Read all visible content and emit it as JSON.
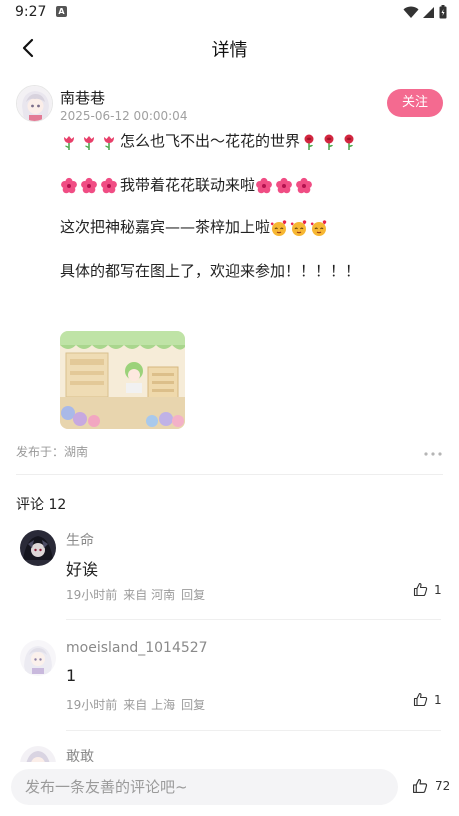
{
  "status_bar": {
    "time": "9:27",
    "notif_letter": "A"
  },
  "header": {
    "title": "详情"
  },
  "author": {
    "name": "南巷巷",
    "date": "2025-06-12 00:00:04",
    "follow_label": "关注"
  },
  "post": {
    "lines": [
      {
        "text": "怎么也飞不出～花花的世界",
        "pre_emoji": [
          "tulip",
          "tulip",
          "tulip"
        ],
        "post_emoji": [
          "rose",
          "rose",
          "rose"
        ]
      },
      {
        "text": "我带着花花联动来啦",
        "pre_emoji": [
          "hibiscus",
          "hibiscus",
          "hibiscus"
        ],
        "post_emoji": [
          "hibiscus",
          "hibiscus",
          "hibiscus"
        ]
      },
      {
        "text": "这次把神秘嘉宾——茶梓加上啦",
        "pre_emoji": [],
        "post_emoji": [
          "love-face",
          "love-face",
          "love-face"
        ]
      },
      {
        "text": "具体的都写在图上了，欢迎来参加！！！！！",
        "pre_emoji": [],
        "post_emoji": []
      }
    ],
    "location": "发布于：湖南"
  },
  "comments_header": "评论 12",
  "comments": [
    {
      "user": "生命",
      "text": "好诶",
      "time": "19小时前",
      "origin": "来自 河南",
      "reply": "回复",
      "likes": "1"
    },
    {
      "user": "moeisland_1014527",
      "text": "1",
      "time": "19小时前",
      "origin": "来自 上海",
      "reply": "回复",
      "likes": "1"
    },
    {
      "user": "敢敢",
      "text": "",
      "time": "",
      "origin": "",
      "reply": "",
      "likes": ""
    }
  ],
  "bottom": {
    "input_placeholder": "发布一条友善的评论吧~",
    "like_count": "72"
  },
  "colors": {
    "accent": "#f46a90",
    "text": "#222222",
    "muted": "#9a9a9a"
  }
}
